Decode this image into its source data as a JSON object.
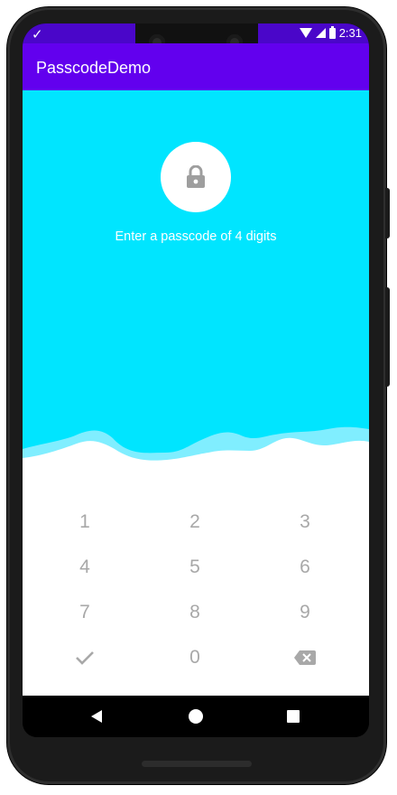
{
  "status_bar": {
    "time": "2:31",
    "notification_icon": "check-icon"
  },
  "app_bar": {
    "title": "PasscodeDemo"
  },
  "lock": {
    "icon": "lock-icon",
    "prompt": "Enter a passcode of 4 digits"
  },
  "keypad": {
    "keys": [
      {
        "id": "1",
        "label": "1"
      },
      {
        "id": "2",
        "label": "2"
      },
      {
        "id": "3",
        "label": "3"
      },
      {
        "id": "4",
        "label": "4"
      },
      {
        "id": "5",
        "label": "5"
      },
      {
        "id": "6",
        "label": "6"
      },
      {
        "id": "7",
        "label": "7"
      },
      {
        "id": "8",
        "label": "8"
      },
      {
        "id": "9",
        "label": "9"
      },
      {
        "id": "confirm",
        "icon": "check-icon"
      },
      {
        "id": "0",
        "label": "0"
      },
      {
        "id": "backspace",
        "icon": "backspace-icon"
      }
    ]
  },
  "colors": {
    "status_bar": "#4a06c9",
    "app_bar": "#6200ee",
    "header": "#00e5ff",
    "keys": "#a8a8a8"
  }
}
